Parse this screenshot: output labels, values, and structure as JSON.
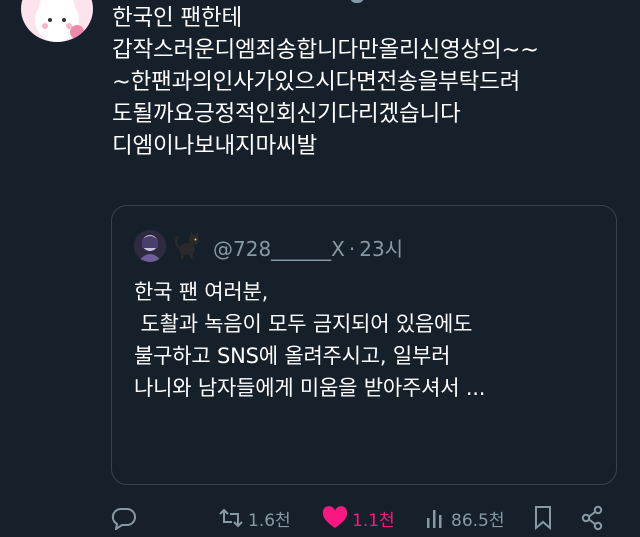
{
  "tweet": {
    "lines": [
      "한국인 팬한테",
      "갑작스러운디엠죄송합니다만올리신영상의~~",
      "~한팬과의인사가있으시다면전송을부탁드려",
      "도될까요긍정적인회신기다리겠습니다",
      "디엠이나보내지마씨발"
    ]
  },
  "quote": {
    "emoji": "🐈‍⬛",
    "handle": "@728______X",
    "separator": "·",
    "time": "23시",
    "lines": [
      "한국 팬 여러분,",
      "",
      " 도촬과 녹음이 모두 금지되어 있음에도",
      "불구하고 SNS에 올려주시고, 일부러",
      "나니와 남자들에게 미움을 받아주셔서 ..."
    ]
  },
  "actions": {
    "reply_count": "",
    "retweet_count": "1.6천",
    "like_count": "1.1천",
    "view_count": "86.5천"
  },
  "colors": {
    "background": "#15202b",
    "secondary_text": "#8899a6",
    "like": "#f91880",
    "border": "#38444d"
  }
}
